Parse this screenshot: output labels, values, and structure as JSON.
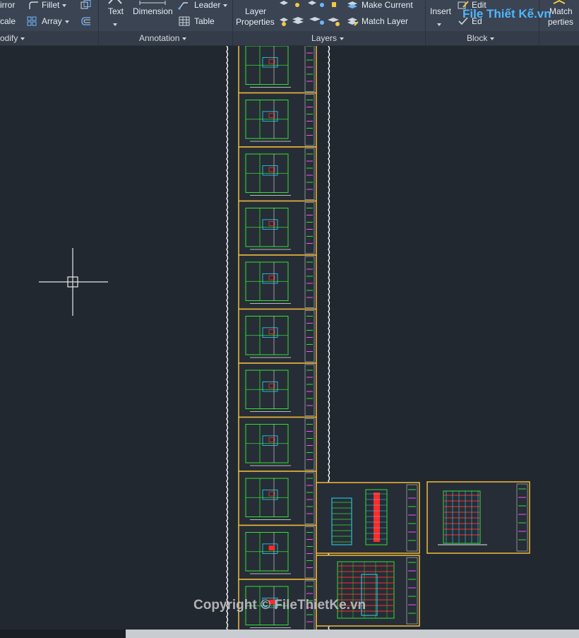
{
  "ribbon": {
    "modify": {
      "mirror": "irror",
      "scale": "cale",
      "fillet": "Fillet",
      "array": "Array",
      "panel_label": "odify"
    },
    "annotation": {
      "text": "Text",
      "dimension": "Dimension",
      "leader": "Leader",
      "table": "Table",
      "panel_label": "Annotation"
    },
    "layers": {
      "layer_properties_line1": "Layer",
      "layer_properties_line2": "Properties",
      "make_current": "Make Current",
      "match_layer": "Match Layer",
      "panel_label": "Layers"
    },
    "block": {
      "insert": "Insert",
      "edit": "Edit",
      "edit2": "Ed",
      "panel_label": "Block"
    },
    "properties": {
      "match_line1": "Match",
      "match_line2": "perties"
    }
  },
  "watermark": {
    "top": "File Thiết Kế.vn",
    "bottom": "Copyright © FileThietKe.vn"
  },
  "colors": {
    "ribbon_bg": "#3b4453",
    "canvas_bg": "#212830",
    "sheet_border": "#e7b23a",
    "cad_green": "#32e032",
    "cad_red": "#ff2a2a",
    "cad_cyan": "#2ad6ff",
    "cad_magenta": "#ff4dff"
  },
  "icons": [
    "mirror-icon",
    "scale-icon",
    "fillet-icon",
    "array-icon",
    "text-icon",
    "dimension-icon",
    "leader-icon",
    "table-icon",
    "layer-properties-icon",
    "make-current-icon",
    "match-layer-icon",
    "insert-icon",
    "edit-block-icon",
    "match-properties-icon",
    "crosshair-cursor-icon"
  ]
}
